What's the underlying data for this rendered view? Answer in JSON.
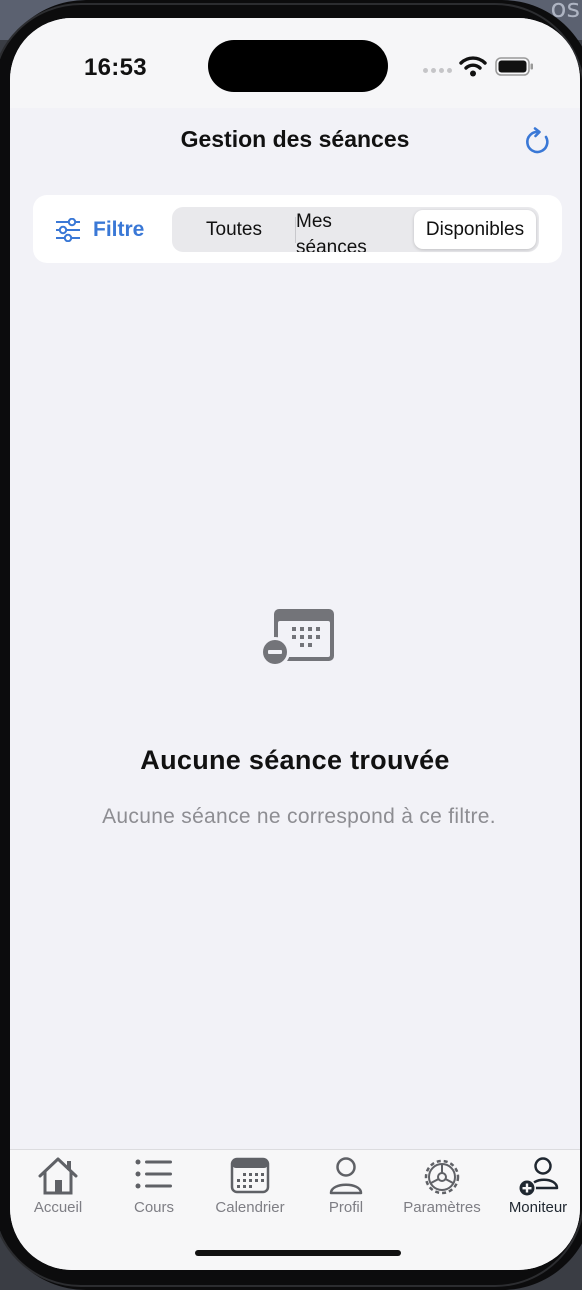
{
  "status": {
    "time": "16:53"
  },
  "nav": {
    "title": "Gestion des séances",
    "refresh_icon": "arrow-clockwise-icon"
  },
  "filter": {
    "label": "Filtre",
    "icon": "sliders-icon",
    "segments": [
      "Toutes",
      "Mes séances",
      "Disponibles"
    ],
    "selected": "Disponibles"
  },
  "empty_state": {
    "icon": "calendar-minus-icon",
    "title": "Aucune séance trouvée",
    "message": "Aucune séance ne correspond à ce filtre."
  },
  "tabbar": {
    "items": [
      {
        "label": "Accueil",
        "icon": "house-icon"
      },
      {
        "label": "Cours",
        "icon": "list-icon"
      },
      {
        "label": "Calendrier",
        "icon": "calendar-icon"
      },
      {
        "label": "Profil",
        "icon": "person-icon"
      },
      {
        "label": "Paramètres",
        "icon": "gear-icon"
      },
      {
        "label": "Moniteur",
        "icon": "person-add-icon"
      }
    ],
    "active": "Moniteur"
  },
  "colors": {
    "accent": "#3a78d6",
    "background": "#f2f2f7",
    "secondary_text": "#8d8d92",
    "icon_gray": "#5f6166"
  }
}
